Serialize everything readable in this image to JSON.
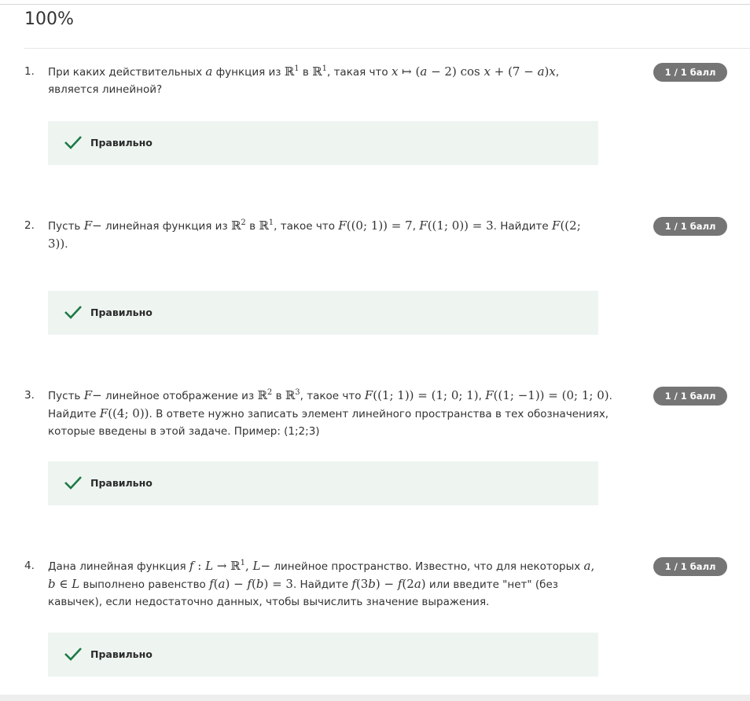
{
  "score": "100%",
  "badge": "1 / 1 балл",
  "correct_label": "Правильно",
  "questions": [
    {
      "number": "1.",
      "t1": "При каких действительных ",
      "t2": " функция из ",
      "t3": " в ",
      "t4": ", такая что ",
      "t5": ", является линейной?"
    },
    {
      "number": "2.",
      "t1": "Пусть ",
      "t2": " линейная функция из ",
      "t3": " в ",
      "t4": ", такое что ",
      "t5": ". Найдите "
    },
    {
      "number": "3.",
      "t1": "Пусть ",
      "t2": " линейное отображение из ",
      "t3": " в ",
      "t4": ", такое что ",
      "t5": "Найдите ",
      "t6": ". В ответе нужно записать элемент линейного пространства в тех обозначениях, которые введены в этой задаче. Пример: (1;2;3)"
    },
    {
      "number": "4.",
      "t1": "Дана линейная функция ",
      "t2": " линейное пространство. Известно, что для некоторых ",
      "t3": " выполнено равенство ",
      "t4": ". Найдите ",
      "t5": " или введите \"нет\" (без кавычек), если недостаточно данных, чтобы вычислить значение выражения."
    }
  ]
}
